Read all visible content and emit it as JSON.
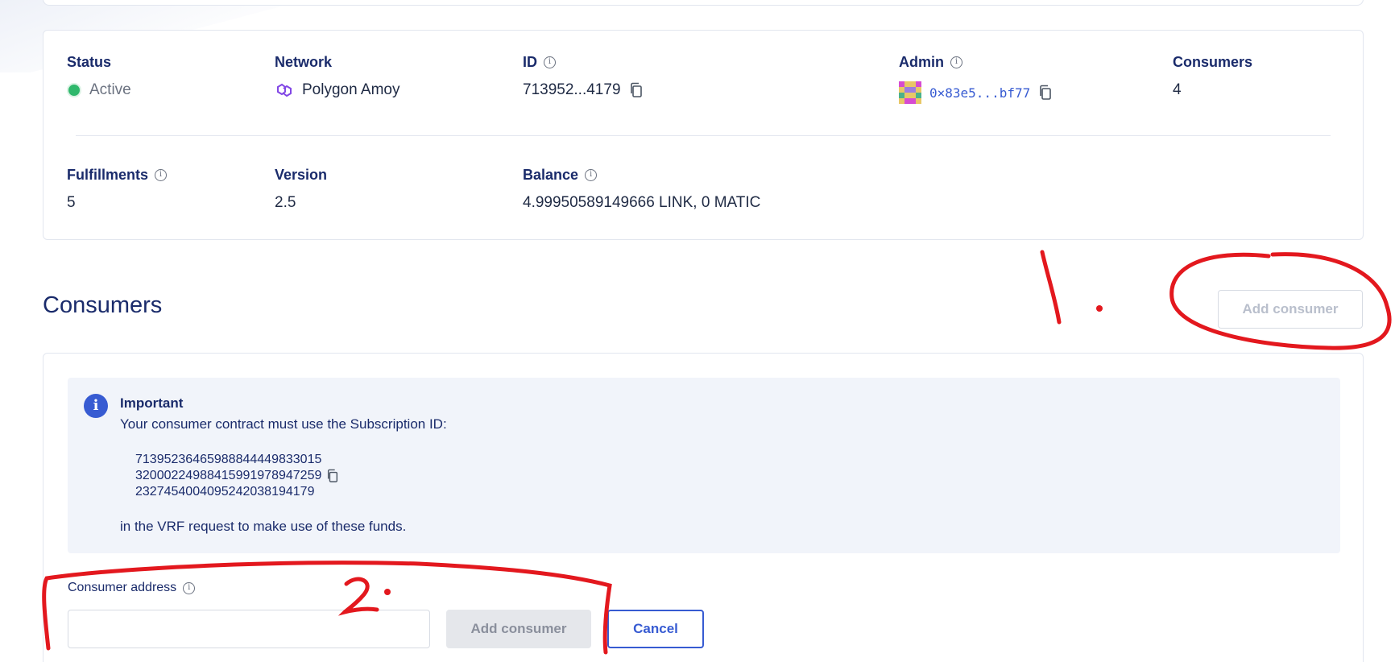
{
  "details": {
    "status": {
      "label": "Status",
      "value": "Active"
    },
    "network": {
      "label": "Network",
      "value": "Polygon Amoy"
    },
    "id": {
      "label": "ID",
      "value": "713952...4179"
    },
    "admin": {
      "label": "Admin",
      "value": "0×83e5...bf77"
    },
    "consumers": {
      "label": "Consumers",
      "value": "4"
    },
    "fulfillments": {
      "label": "Fulfillments",
      "value": "5"
    },
    "version": {
      "label": "Version",
      "value": "2.5"
    },
    "balance": {
      "label": "Balance",
      "value": "4.99950589149666 LINK, 0 MATIC"
    }
  },
  "consumers_section": {
    "title": "Consumers",
    "add_button_label": "Add consumer",
    "notice": {
      "title": "Important",
      "line": "Your consumer contract must use the Subscription ID:",
      "subscription_id_lines": [
        "71395236465988844449833015",
        "32000224988415991978947259",
        "23274540040952420381941​79"
      ],
      "footer": "in the VRF request to make use of these funds."
    },
    "form": {
      "address_label": "Consumer address",
      "address_value": "",
      "add_label": "Add consumer",
      "cancel_label": "Cancel"
    }
  },
  "annotations": {
    "marker_1": "1.",
    "marker_2": "2."
  },
  "colors": {
    "accent": "#375bd2",
    "active": "#2fb86c",
    "annotation": "#e3181e",
    "network": "#8247e5"
  },
  "icons": [
    "info-icon",
    "polygon-icon",
    "copy-icon",
    "admin-avatar-icon",
    "status-active-dot-icon"
  ]
}
